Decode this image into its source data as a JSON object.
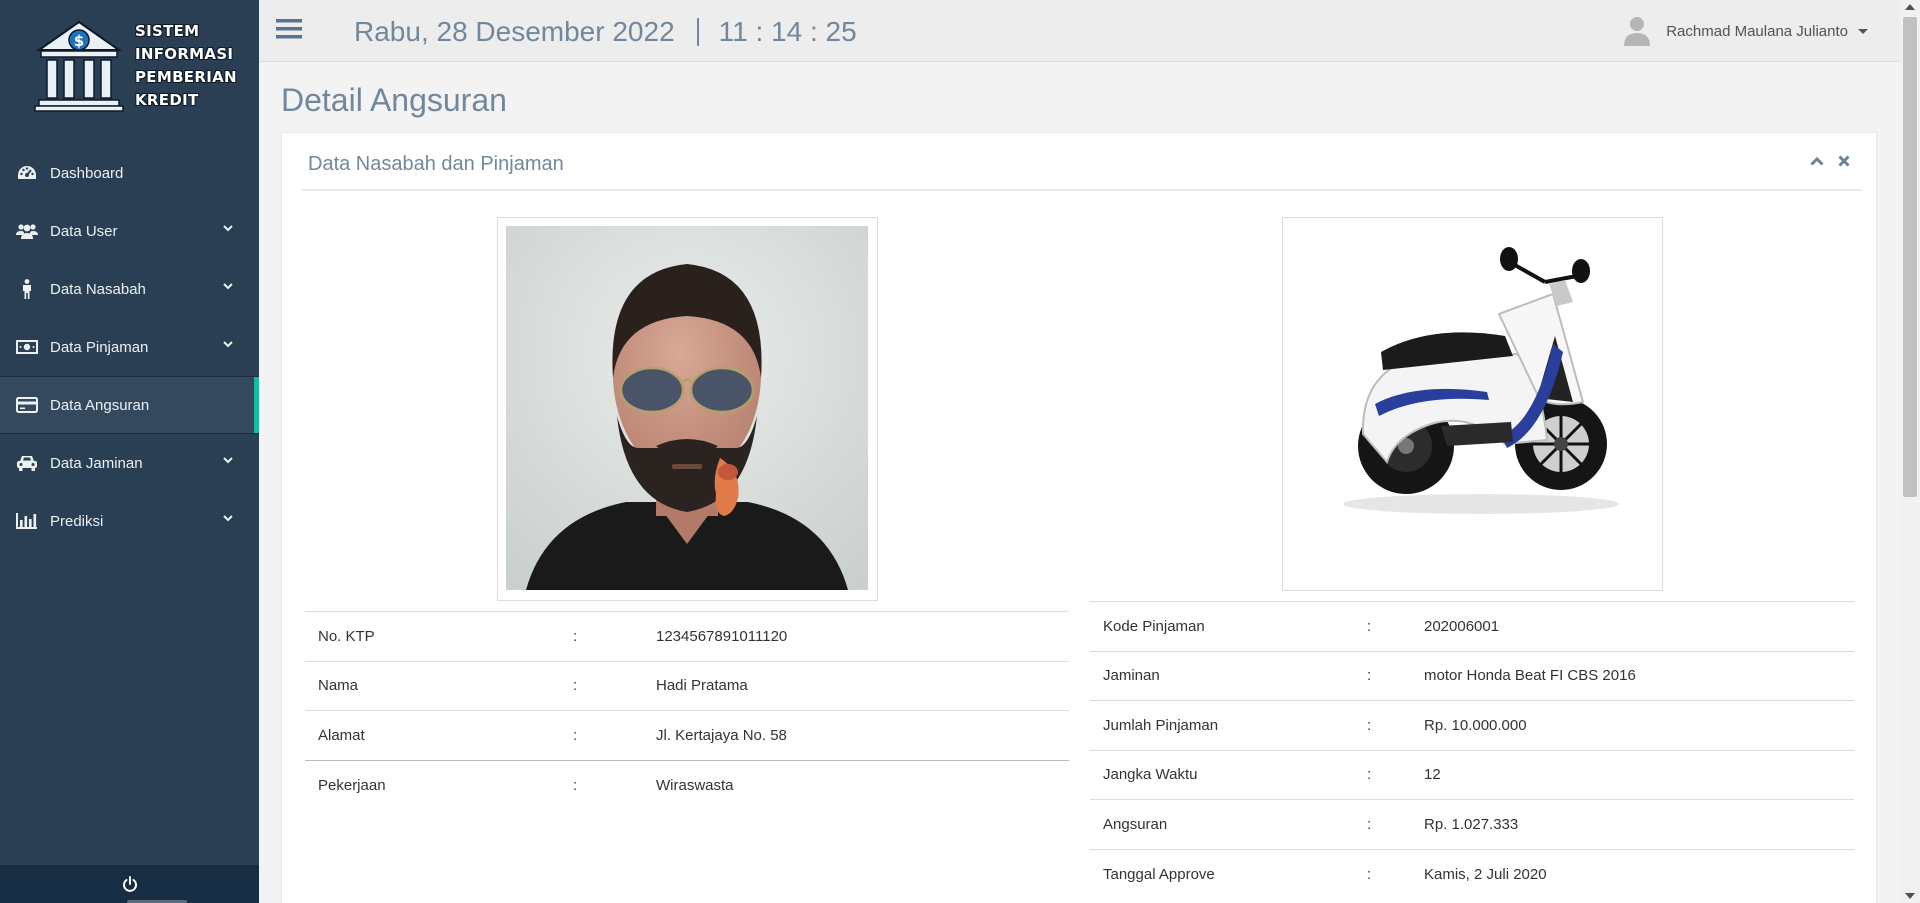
{
  "brand": {
    "lines": [
      "SISTEM",
      "INFORMASI",
      "PEMBERIAN",
      "KREDIT"
    ],
    "logo_icon": "bank-icon"
  },
  "sidebar": {
    "items": [
      {
        "label": "Dashboard",
        "icon": "dashboard-icon",
        "has_submenu": false,
        "active": false
      },
      {
        "label": "Data User",
        "icon": "users-icon",
        "has_submenu": true,
        "active": false
      },
      {
        "label": "Data Nasabah",
        "icon": "person-icon",
        "has_submenu": true,
        "active": false
      },
      {
        "label": "Data Pinjaman",
        "icon": "money-icon",
        "has_submenu": true,
        "active": false
      },
      {
        "label": "Data Angsuran",
        "icon": "credit-card-icon",
        "has_submenu": false,
        "active": true
      },
      {
        "label": "Data Jaminan",
        "icon": "car-icon",
        "has_submenu": true,
        "active": false
      },
      {
        "label": "Prediksi",
        "icon": "bar-chart-icon",
        "has_submenu": true,
        "active": false
      }
    ],
    "footer_icon": "power-icon"
  },
  "topnav": {
    "date": "Rabu, 28 Desember 2022",
    "time": "11 : 14 : 25",
    "user_name": "Rachmad Maulana Julianto"
  },
  "page": {
    "title": "Detail Angsuran"
  },
  "panel": {
    "title": "Data Nasabah dan Pinjaman"
  },
  "nasabah": [
    {
      "label": "No. KTP",
      "sep": ":",
      "value": "1234567891011120"
    },
    {
      "label": "Nama",
      "sep": ":",
      "value": "Hadi Pratama"
    },
    {
      "label": "Alamat",
      "sep": ":",
      "value": "Jl. Kertajaya No. 58"
    },
    {
      "label": "Pekerjaan",
      "sep": ":",
      "value": "Wiraswasta"
    }
  ],
  "pinjaman": [
    {
      "label": "Kode Pinjaman",
      "sep": ":",
      "value": "202006001"
    },
    {
      "label": "Jaminan",
      "sep": ":",
      "value": "motor Honda Beat FI CBS 2016"
    },
    {
      "label": "Jumlah Pinjaman",
      "sep": ":",
      "value": "Rp. 10.000.000"
    },
    {
      "label": "Jangka Waktu",
      "sep": ":",
      "value": "12"
    },
    {
      "label": "Angsuran",
      "sep": ":",
      "value": "Rp. 1.027.333"
    },
    {
      "label": "Tanggal Approve",
      "sep": ":",
      "value": "Kamis, 2 Juli 2020"
    }
  ],
  "colors": {
    "sidebar_bg": "#2a3f54",
    "active_accent": "#1abb9c",
    "title_text": "#73879c"
  }
}
